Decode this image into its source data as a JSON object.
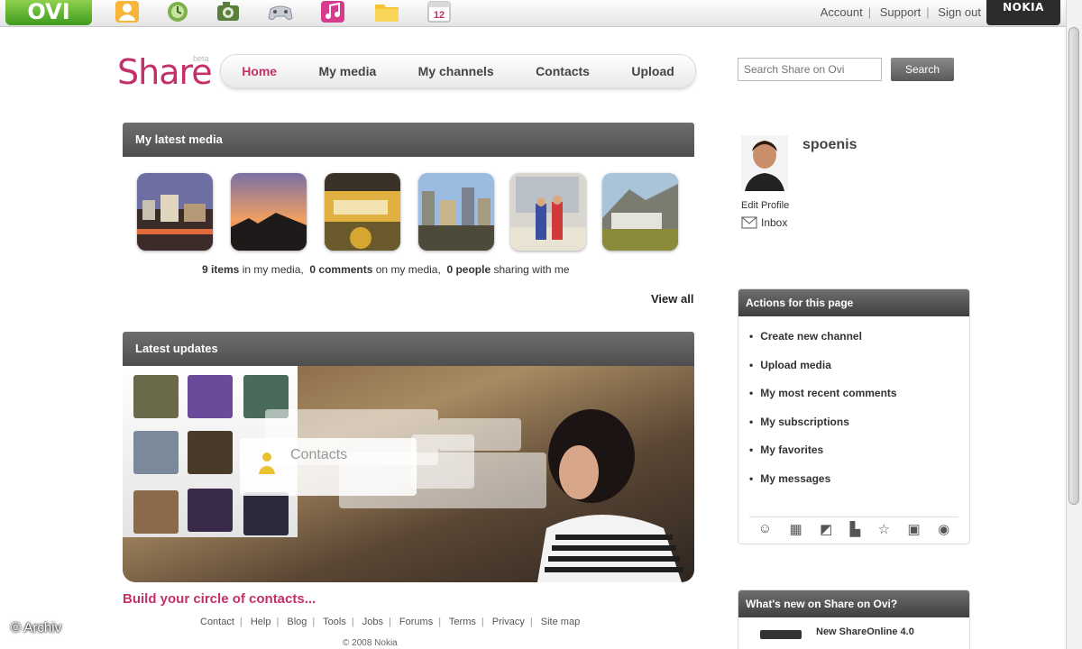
{
  "topbar": {
    "logo": "OVI",
    "apps": [
      {
        "icon": "contacts-app-icon"
      },
      {
        "icon": "clock-app-icon"
      },
      {
        "icon": "camera-app-icon"
      },
      {
        "icon": "games-app-icon"
      },
      {
        "icon": "music-app-icon"
      },
      {
        "icon": "files-app-icon"
      },
      {
        "icon": "calendar-app-icon",
        "text": "12"
      }
    ],
    "links": [
      "Account",
      "Support",
      "Sign out"
    ],
    "brand": "NOKIA"
  },
  "header": {
    "logo": "Share",
    "beta": "beta",
    "nav": [
      "Home",
      "My media",
      "My channels",
      "Contacts",
      "Upload"
    ],
    "active_nav": "Home",
    "search_placeholder": "Search Share on Ovi",
    "search_button": "Search"
  },
  "latest_media": {
    "title": "My latest media",
    "stats": {
      "items_count": "9 items",
      "items_suffix": " in my media,",
      "comments_count": "0 comments",
      "comments_suffix": " on my media,",
      "people_count": "0 people",
      "people_suffix": " sharing with me"
    },
    "view_all": "View all"
  },
  "latest_updates": {
    "title": "Latest updates",
    "overlay_label": "Contacts",
    "cta": "Build your circle of contacts..."
  },
  "profile": {
    "username": "spoenis",
    "edit_profile": "Edit Profile",
    "inbox": "Inbox"
  },
  "actions_panel": {
    "title": "Actions for this page",
    "items": [
      "Create new channel",
      "Upload media",
      "My most recent comments",
      "My subscriptions",
      "My favorites",
      "My messages"
    ],
    "share_icons": [
      "smiley-icon",
      "grid-icon",
      "delicious-icon",
      "chart-icon",
      "star-icon",
      "facebook-icon",
      "rss-icon"
    ]
  },
  "news_panel": {
    "title": "What's new on Share on Ovi?",
    "item": "New ShareOnline 4.0"
  },
  "footer": {
    "links": [
      "Contact",
      "Help",
      "Blog",
      "Tools",
      "Jobs",
      "Forums",
      "Terms",
      "Privacy",
      "Site map"
    ],
    "copyright": "© 2008 Nokia"
  },
  "watermark": "© Archiv"
}
